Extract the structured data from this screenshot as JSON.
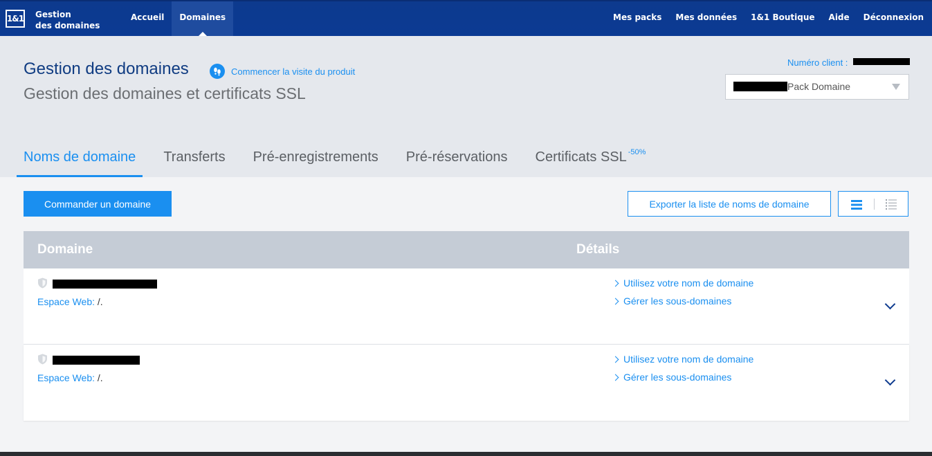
{
  "brand": {
    "logo": "1&1",
    "line1": "Gestion",
    "line2": "des domaines"
  },
  "nav_main": [
    {
      "label": "Accueil",
      "active": false
    },
    {
      "label": "Domaines",
      "active": true
    }
  ],
  "nav_right": [
    "Mes packs",
    "Mes données",
    "1&1 Boutique",
    "Aide",
    "Déconnexion"
  ],
  "header": {
    "title": "Gestion des domaines",
    "tour_label": "Commencer la visite du produit",
    "subtitle": "Gestion des domaines et certificats SSL",
    "client_label": "Numéro client :",
    "pack_select_value": "Pack Domaine"
  },
  "tabs": [
    {
      "label": "Noms de domaine",
      "active": true,
      "badge": ""
    },
    {
      "label": "Transferts",
      "active": false,
      "badge": ""
    },
    {
      "label": "Pré-enregistrements",
      "active": false,
      "badge": ""
    },
    {
      "label": "Pré-réservations",
      "active": false,
      "badge": ""
    },
    {
      "label": "Certificats SSL",
      "active": false,
      "badge": "-50%"
    }
  ],
  "actions": {
    "order_label": "Commander un domaine",
    "export_label": "Exporter la liste de noms de domaine"
  },
  "table": {
    "col_domain": "Domaine",
    "col_details": "Détails",
    "rows": [
      {
        "espace_label": "Espace Web:",
        "espace_value": "/.",
        "link1": "Utilisez votre nom de domaine",
        "link2": "Gérer les sous-domaines"
      },
      {
        "espace_label": "Espace Web:",
        "espace_value": "/.",
        "link1": "Utilisez votre nom de domaine",
        "link2": "Gérer les sous-domaines"
      }
    ]
  },
  "colors": {
    "nav_bg": "#0b3a93",
    "accent": "#1a8ff0",
    "title": "#103c82",
    "table_header": "#c5ccd6"
  }
}
